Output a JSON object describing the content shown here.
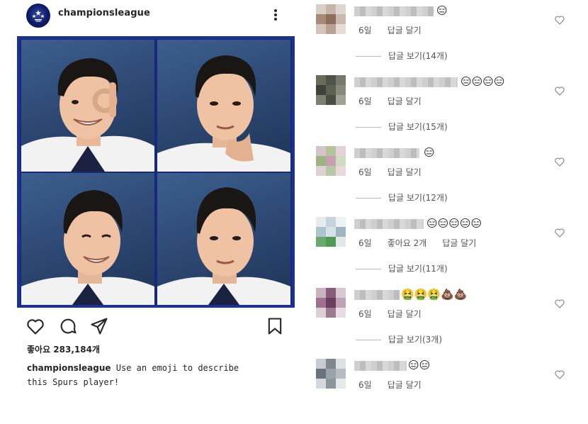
{
  "post": {
    "username": "championsleague",
    "likes": "좋아요 283,184개",
    "caption_user": "championsleague",
    "caption_text": " Use an emoji to describe this Spurs player!"
  },
  "comments": [
    {
      "emoji": "😑",
      "time": "6일",
      "likes_text": "",
      "reply": "답글 달기",
      "view_replies": "답글 보기(14개)"
    },
    {
      "emoji": "😑😑😑😑",
      "time": "6일",
      "likes_text": "",
      "reply": "답글 달기",
      "view_replies": "답글 보기(15개)"
    },
    {
      "emoji": "😑",
      "time": "6일",
      "likes_text": "",
      "reply": "답글 달기",
      "view_replies": "답글 보기(12개)"
    },
    {
      "emoji": "😑😑😑😑😑",
      "time": "6일",
      "likes_text": "좋아요 2개",
      "reply": "답글 달기",
      "view_replies": "답글 보기(11개)"
    },
    {
      "emoji": "🤮🤮🤮💩💩",
      "time": "6일",
      "likes_text": "",
      "reply": "답글 달기",
      "view_replies": "답글 보기(3개)"
    },
    {
      "emoji": "😑😑",
      "time": "6일",
      "likes_text": "",
      "reply": "답글 달기",
      "view_replies": ""
    }
  ],
  "icons": {
    "more": "more-options-icon",
    "like": "heart-icon",
    "comment": "comment-icon",
    "share": "send-icon",
    "save": "bookmark-icon",
    "comment_like": "heart-icon"
  },
  "colors": {
    "photo_border": "#1c3290",
    "tile_bg": "#2b4670",
    "text": "#262626",
    "meta": "#555555"
  }
}
